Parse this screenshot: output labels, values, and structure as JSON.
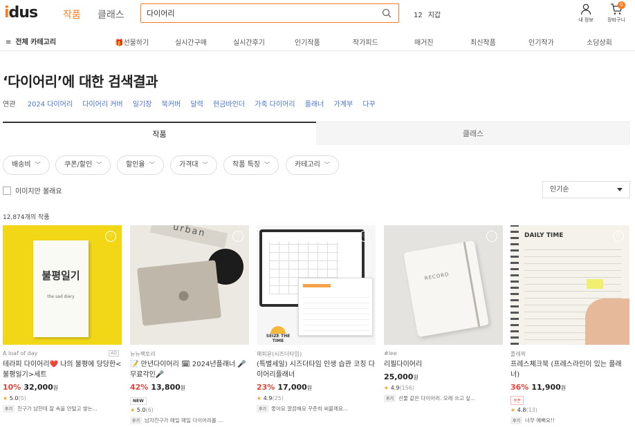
{
  "header": {
    "logo_i": "i",
    "logo_rest": "dus",
    "tab_works": "작품",
    "tab_classes": "클래스",
    "search_value": "다이어리",
    "rank_num": "12",
    "rank_word": "지갑",
    "my_info": "내 정보",
    "cart": "장바구니",
    "cart_count": "0"
  },
  "nav": {
    "all_categories": "전체 카테고리",
    "items": [
      "선물하기",
      "실시간구매",
      "실시간후기",
      "인기작품",
      "작가피드",
      "매거진",
      "최신작품",
      "인기작가",
      "소담상회"
    ]
  },
  "search_title": "‘다이어리’에 대한 검색결과",
  "related": {
    "label": "연관",
    "keywords": [
      "2024 다이어리",
      "다이어리 커버",
      "일기장",
      "북커버",
      "달력",
      "현금바인더",
      "가죽 다이어리",
      "플래너",
      "가계부",
      "다꾸"
    ]
  },
  "result_tabs": {
    "works": "작품",
    "classes": "클래스"
  },
  "filters": [
    "배송비",
    "쿠폰/할인",
    "할인율",
    "가격대",
    "작품 특징",
    "카테고리"
  ],
  "image_only_label": "이미지만 볼래요",
  "sort": "인기순",
  "result_count": "12,874개의 작품",
  "colors": {
    "accent": "#ff7a1a",
    "discount": "#e0463b",
    "link": "#4a73c9",
    "star": "#f5a623"
  },
  "products": [
    {
      "seller": "A loaf of day",
      "ad": "AD",
      "name": "테라피 다이어리❤️ 나의 불평에 당당한<불평일기>세트",
      "discount": "10%",
      "price": "32,000",
      "won": "원",
      "tag": "",
      "rating": "5.0",
      "reviews": "(5)",
      "review_label": "후기",
      "review_text": "친구가 남한테 잘 속을 안털고 쌓는..."
    },
    {
      "seller": "뉴뉴팩토리",
      "ad": "",
      "name": "📝 만년다이어리 🗓 2024년플래너 🎤무료각인🎤",
      "discount": "42%",
      "price": "13,800",
      "won": "원",
      "tag": "NEW",
      "rating": "5.0",
      "reviews": "(6)",
      "review_label": "후기",
      "review_text": "남자친구가 매일 매일 다이어리를 ..."
    },
    {
      "seller": "해피윤(시즈더타임)",
      "ad": "",
      "name": "(특별세일) 시즈더타임 인생 습관 코칭 다이어리플래너",
      "discount": "23%",
      "price": "17,000",
      "won": "원",
      "tag": "",
      "rating": "4.9",
      "reviews": "(25)",
      "review_label": "후기",
      "review_text": "좋아요 깔끔해요 꾸준히 써볼께요..."
    },
    {
      "seller": "#lee",
      "ad": "",
      "name": "리필다이어리",
      "discount": "",
      "price": "25,000",
      "won": "원",
      "tag": "",
      "rating": "4.9",
      "reviews": "(156)",
      "review_label": "후기",
      "review_text": "선물 같은 다이어리. 오래 쓰고 싶..."
    },
    {
      "seller": "플레픽",
      "ad": "",
      "name": "프레스체크북 (프레스라인이 있는 플래너)",
      "discount": "36%",
      "price": "11,900",
      "won": "원",
      "tag": "쿠폰",
      "rating": "4.8",
      "reviews": "(13)",
      "review_label": "후기",
      "review_text": "너무 예뻐요!!"
    }
  ],
  "thumb_text": {
    "p1_cover": "불평일기",
    "p1_sub": "the sad diary",
    "p3_brand": "SEIZE THE TIME",
    "p4_cover": "RECORD",
    "p5_header": "DAILY TIME"
  }
}
